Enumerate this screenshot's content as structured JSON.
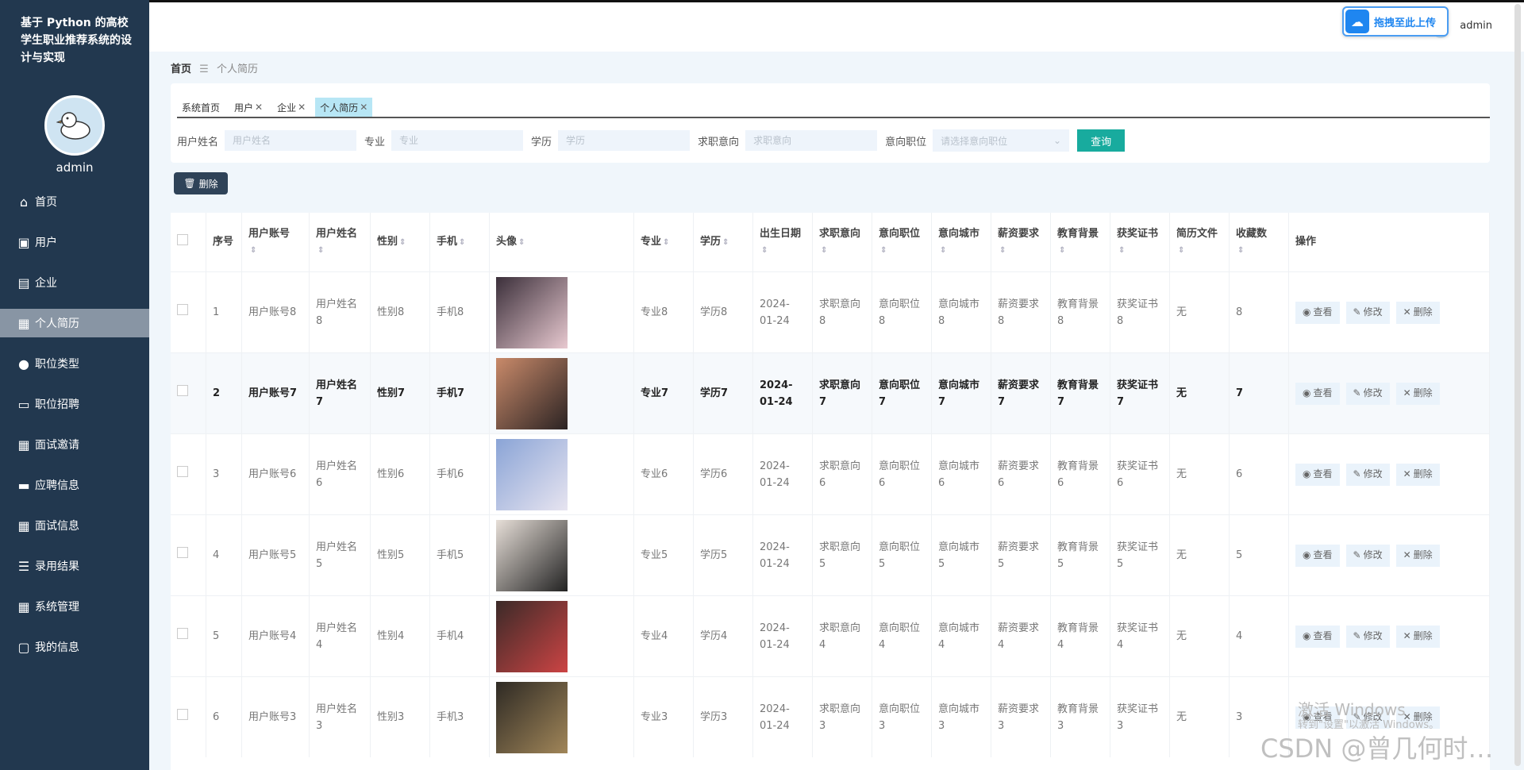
{
  "sidebar": {
    "title": "基于 Python 的高校学生职业推荐系统的设计与实现",
    "username": "admin",
    "items": [
      {
        "label": "首页",
        "icon": "home-icon"
      },
      {
        "label": "用户",
        "icon": "briefcase-icon"
      },
      {
        "label": "企业",
        "icon": "clipboard-icon"
      },
      {
        "label": "个人简历",
        "icon": "grid-icon"
      },
      {
        "label": "职位类型",
        "icon": "person-icon"
      },
      {
        "label": "职位招聘",
        "icon": "monitor-icon"
      },
      {
        "label": "面试邀请",
        "icon": "grid-icon"
      },
      {
        "label": "应聘信息",
        "icon": "ticket-icon"
      },
      {
        "label": "面试信息",
        "icon": "grid-icon"
      },
      {
        "label": "录用结果",
        "icon": "list-icon"
      },
      {
        "label": "系统管理",
        "icon": "apps-icon"
      },
      {
        "label": "我的信息",
        "icon": "card-icon"
      }
    ],
    "active_index": 3
  },
  "header": {
    "upload_label": "拖拽至此上传",
    "user": "admin"
  },
  "breadcrumb": {
    "home": "首页",
    "current": "个人简历"
  },
  "tabs": [
    {
      "label": "系统首页",
      "closable": false
    },
    {
      "label": "用户",
      "closable": true
    },
    {
      "label": "企业",
      "closable": true
    },
    {
      "label": "个人简历",
      "closable": true,
      "active": true
    }
  ],
  "search": {
    "fields": [
      {
        "label": "用户姓名",
        "placeholder": "用户姓名"
      },
      {
        "label": "专业",
        "placeholder": "专业"
      },
      {
        "label": "学历",
        "placeholder": "学历"
      },
      {
        "label": "求职意向",
        "placeholder": "求职意向"
      }
    ],
    "select_label": "意向职位",
    "select_placeholder": "请选择意向职位",
    "query_label": "查询"
  },
  "delete_button": "删除",
  "table": {
    "headers": [
      "序号",
      "用户账号",
      "用户姓名",
      "性别",
      "手机",
      "头像",
      "专业",
      "学历",
      "出生日期",
      "求职意向",
      "意向职位",
      "意向城市",
      "薪资要求",
      "教育背景",
      "获奖证书",
      "简历文件",
      "收藏数",
      "操作"
    ],
    "rows": [
      {
        "no": "1",
        "account": "用户账号8",
        "name": "用户姓名8",
        "gender": "性别8",
        "phone": "手机8",
        "major": "专业8",
        "edu": "学历8",
        "birth": "2024-01-24",
        "intent": "求职意向8",
        "position": "意向职位8",
        "city": "意向城市8",
        "salary": "薪资要求8",
        "background": "教育背景8",
        "award": "获奖证书8",
        "file": "无",
        "fav": "8",
        "highlight": false
      },
      {
        "no": "2",
        "account": "用户账号7",
        "name": "用户姓名7",
        "gender": "性别7",
        "phone": "手机7",
        "major": "专业7",
        "edu": "学历7",
        "birth": "2024-01-24",
        "intent": "求职意向7",
        "position": "意向职位7",
        "city": "意向城市7",
        "salary": "薪资要求7",
        "background": "教育背景7",
        "award": "获奖证书7",
        "file": "无",
        "fav": "7",
        "highlight": true
      },
      {
        "no": "3",
        "account": "用户账号6",
        "name": "用户姓名6",
        "gender": "性别6",
        "phone": "手机6",
        "major": "专业6",
        "edu": "学历6",
        "birth": "2024-01-24",
        "intent": "求职意向6",
        "position": "意向职位6",
        "city": "意向城市6",
        "salary": "薪资要求6",
        "background": "教育背景6",
        "award": "获奖证书6",
        "file": "无",
        "fav": "6",
        "highlight": false
      },
      {
        "no": "4",
        "account": "用户账号5",
        "name": "用户姓名5",
        "gender": "性别5",
        "phone": "手机5",
        "major": "专业5",
        "edu": "学历5",
        "birth": "2024-01-24",
        "intent": "求职意向5",
        "position": "意向职位5",
        "city": "意向城市5",
        "salary": "薪资要求5",
        "background": "教育背景5",
        "award": "获奖证书5",
        "file": "无",
        "fav": "5",
        "highlight": false
      },
      {
        "no": "5",
        "account": "用户账号4",
        "name": "用户姓名4",
        "gender": "性别4",
        "phone": "手机4",
        "major": "专业4",
        "edu": "学历4",
        "birth": "2024-01-24",
        "intent": "求职意向4",
        "position": "意向职位4",
        "city": "意向城市4",
        "salary": "薪资要求4",
        "background": "教育背景4",
        "award": "获奖证书4",
        "file": "无",
        "fav": "4",
        "highlight": false
      },
      {
        "no": "6",
        "account": "用户账号3",
        "name": "用户姓名3",
        "gender": "性别3",
        "phone": "手机3",
        "major": "专业3",
        "edu": "学历3",
        "birth": "2024-01-24",
        "intent": "求职意向3",
        "position": "意向职位3",
        "city": "意向城市3",
        "salary": "薪资要求3",
        "background": "教育背景3",
        "award": "获奖证书3",
        "file": "无",
        "fav": "3",
        "highlight": false
      }
    ],
    "actions": [
      "查看",
      "修改",
      "删除"
    ]
  },
  "overlay": {
    "activate_title": "激活 Windows",
    "activate_sub": "转到\"设置\"以激活 Windows。",
    "csdn": "CSDN @曾几何时…"
  }
}
